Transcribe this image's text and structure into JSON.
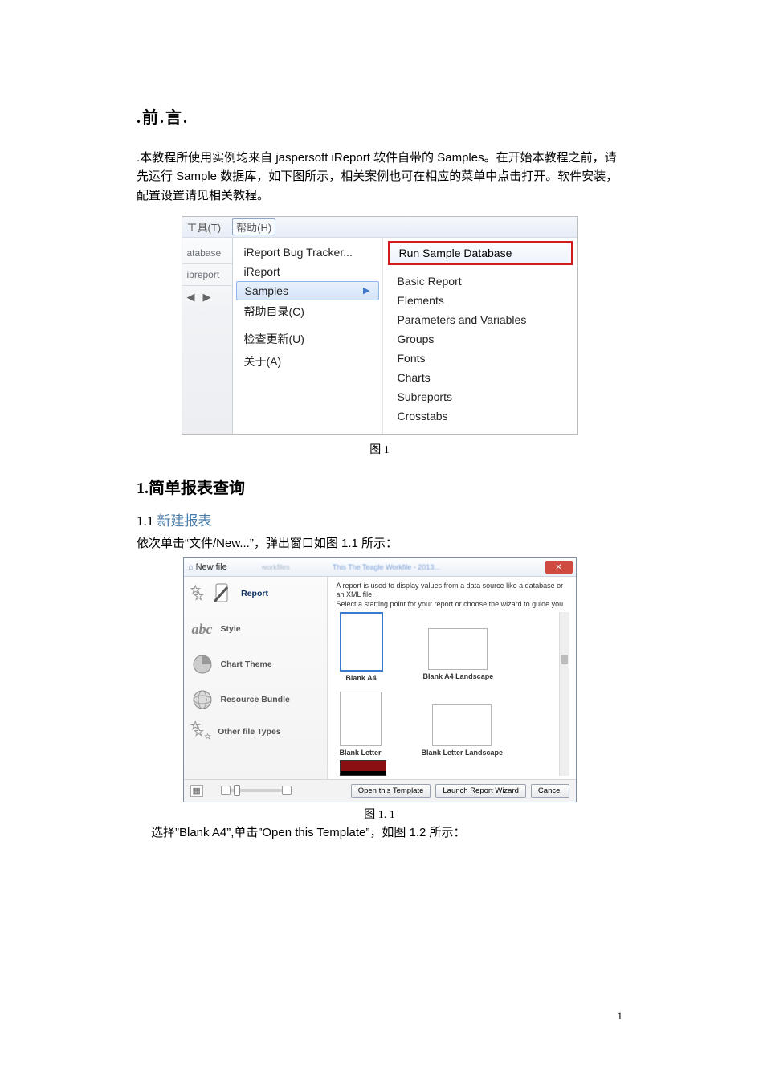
{
  "preface": {
    "title": ".前.言.",
    "para": ".本教程所使用实例均来自 jaspersoft iReport 软件自带的 Samples。在开始本教程之前，请先运行 Sample  数据库，如下图所示，相关案例也可在相应的菜单中点击打开。软件安装，配置设置请见相关教程。"
  },
  "fig1": {
    "menubar_tools": "工具(T)",
    "menubar_help": "帮助(H)",
    "left_items": [
      "atabase",
      "ibreport"
    ],
    "mid_items": [
      "iReport Bug Tracker...",
      "iReport",
      "Samples",
      "帮助目录(C)",
      "检查更新(U)",
      "关于(A)"
    ],
    "right_run": "Run Sample Database",
    "right_items": [
      "Basic Report",
      "Elements",
      "Parameters and Variables",
      "Groups",
      "Fonts",
      "Charts",
      "Subreports",
      "Crosstabs"
    ],
    "caption": "图 1"
  },
  "section1": {
    "heading": "1.简单报表查询",
    "sub_heading_num": "1.1 ",
    "sub_heading_text": "新建报表",
    "para": "依次单击“文件/New...”，弹出窗口如图 1.1 所示："
  },
  "fig11": {
    "title": "New file",
    "title_blur1": "workfiles",
    "title_blur2": "This The Teagle Workfile - 2013...",
    "close_glyph": "✕",
    "desc1": "A report is used to display values from a data source like a database or an XML file.",
    "desc2": "Select a starting point for your report or choose the wizard to guide you.",
    "categories": [
      "Report",
      "Style",
      "Chart Theme",
      "Resource Bundle",
      "Other file Types"
    ],
    "thumbs": [
      "Blank A4",
      "Blank A4 Landscape",
      "Blank Letter",
      "Blank Letter Landscape"
    ],
    "buttons": {
      "open": "Open this Template",
      "wizard": "Launch Report Wizard",
      "cancel": "Cancel"
    },
    "caption": "图 1. 1"
  },
  "after_fig11": "选择”Blank A4”,单击”Open this Template”，如图 1.2 所示：",
  "page_number": "1"
}
